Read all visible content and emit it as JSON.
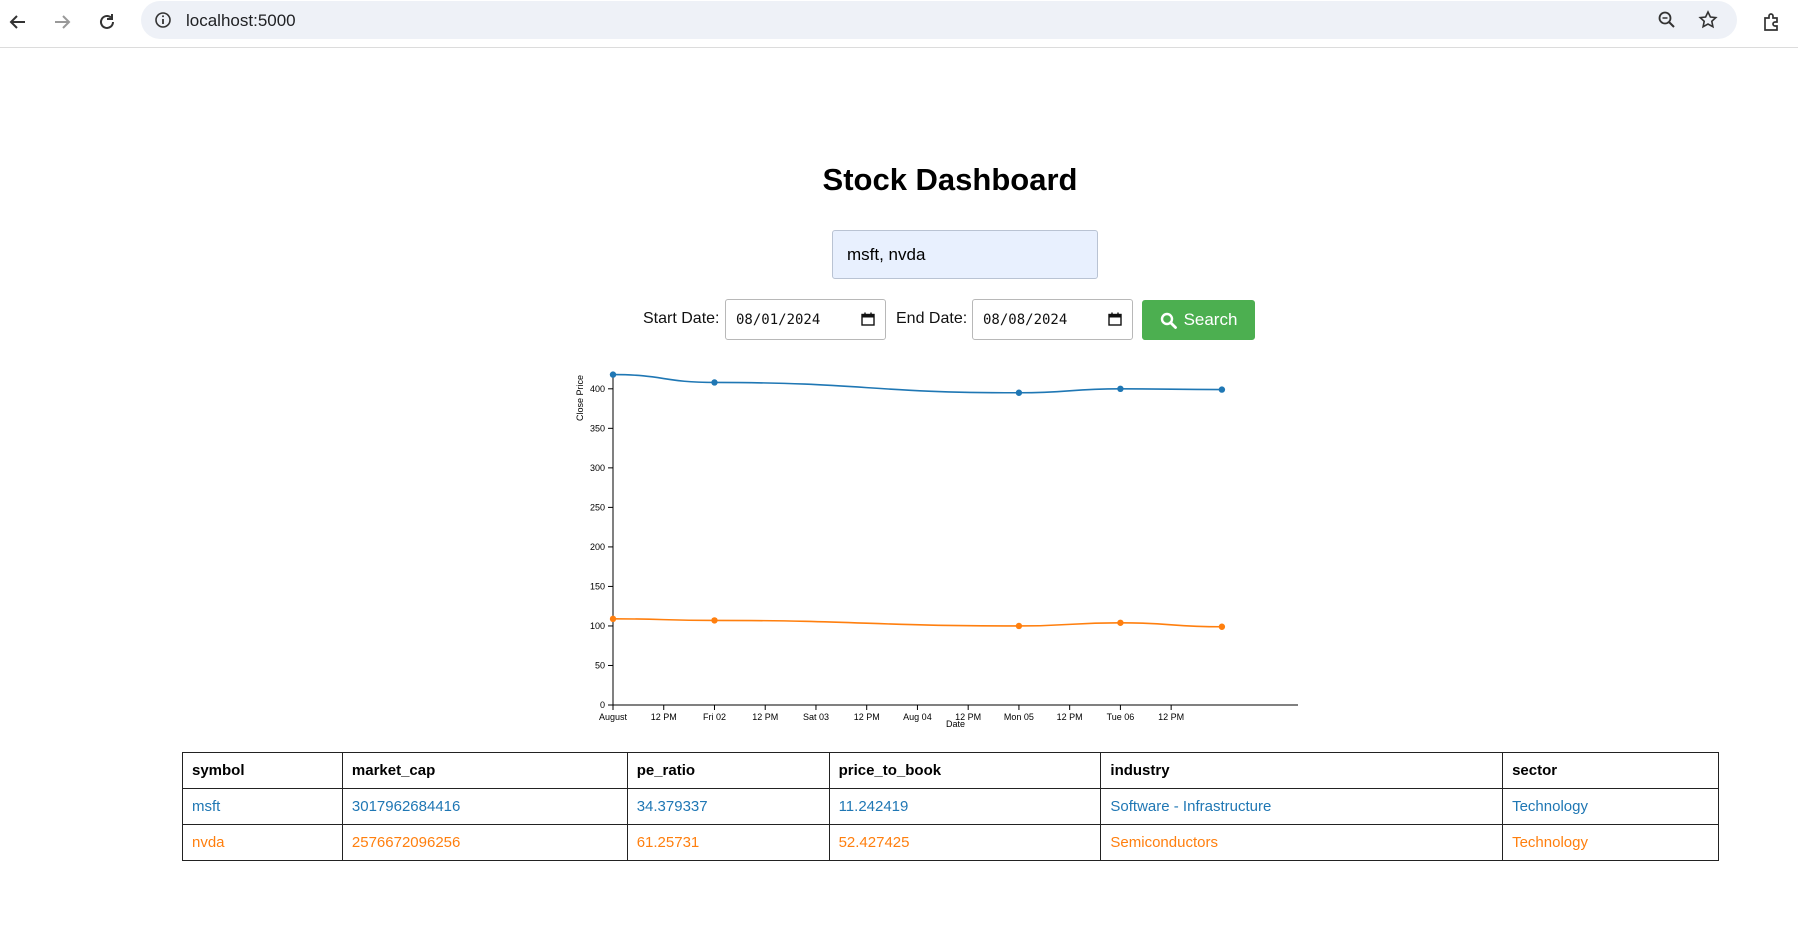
{
  "browser": {
    "url": "localhost:5000",
    "icons": [
      "back-icon",
      "forward-icon",
      "reload-icon",
      "site-info-icon",
      "zoom-icon",
      "star-icon",
      "extensions-icon"
    ]
  },
  "page": {
    "title": "Stock Dashboard",
    "symbols_value": "msft, nvda",
    "start_label": "Start Date:",
    "start_value": "08/01/2024",
    "end_label": "End Date:",
    "end_value": "08/08/2024",
    "search_label": "Search",
    "search_color": "#4caf50"
  },
  "chart_data": {
    "type": "line",
    "xlabel": "Date",
    "ylabel": "Close Price",
    "ylim": [
      0,
      420
    ],
    "xlim": [
      "2024-08-01T00:00",
      "2024-08-07T18:00"
    ],
    "y_ticks": [
      0,
      50,
      100,
      150,
      200,
      250,
      300,
      350,
      400
    ],
    "x_ticks": [
      "August",
      "12 PM",
      "Fri 02",
      "12 PM",
      "Sat 03",
      "12 PM",
      "Aug 04",
      "12 PM",
      "Mon 05",
      "12 PM",
      "Tue 06",
      "12 PM"
    ],
    "x": [
      "2024-08-01",
      "2024-08-02",
      "2024-08-05",
      "2024-08-06",
      "2024-08-07"
    ],
    "series": [
      {
        "name": "msft",
        "color": "#1f77b4",
        "values": [
          418,
          408,
          395,
          400,
          399
        ]
      },
      {
        "name": "nvda",
        "color": "#ff7f0e",
        "values": [
          109,
          107,
          100,
          104,
          99
        ]
      }
    ]
  },
  "table": {
    "headers": [
      "symbol",
      "market_cap",
      "pe_ratio",
      "price_to_book",
      "industry",
      "sector"
    ],
    "rows": [
      [
        "msft",
        "3017962684416",
        "34.379337",
        "11.242419",
        "Software - Infrastructure",
        "Technology"
      ],
      [
        "nvda",
        "2576672096256",
        "61.25731",
        "52.427425",
        "Semiconductors",
        "Technology"
      ]
    ]
  }
}
